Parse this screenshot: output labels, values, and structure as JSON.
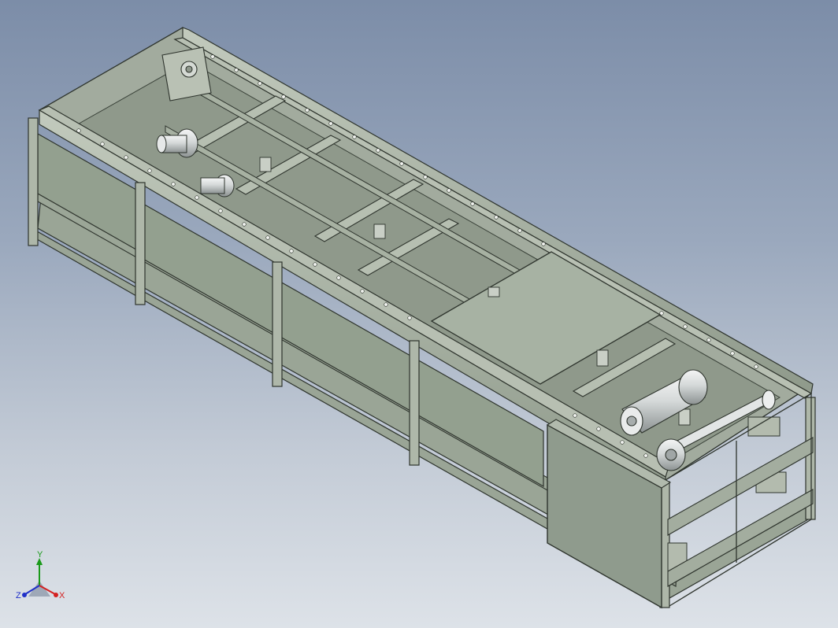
{
  "viewport": {
    "background_top": "#7c8da8",
    "background_bottom": "#dde2e8"
  },
  "model": {
    "frame_color": "#a9b3a5",
    "frame_edge": "#2e342d",
    "panel_color": "#8e9a8c",
    "plate_color": "#a3ad9f",
    "motor_color": "#d9dcdc"
  },
  "triad": {
    "x_label": "X",
    "y_label": "Y",
    "z_label": "Z",
    "x_color": "#d42020",
    "y_color": "#1a9a1a",
    "z_color": "#2030c8",
    "icon": "coordinate-triad-icon"
  }
}
